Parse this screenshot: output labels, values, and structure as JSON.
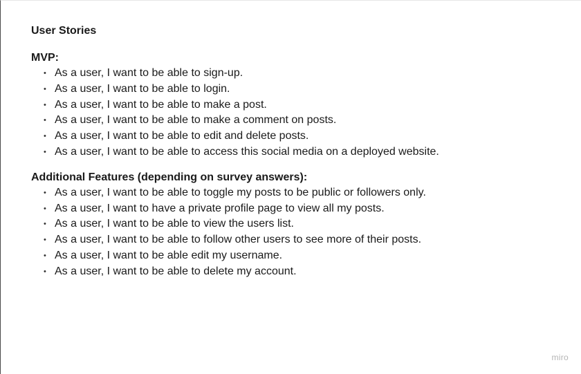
{
  "document": {
    "title": "User Stories",
    "sections": [
      {
        "heading": "MVP:",
        "items": [
          "As a user, I want to be able to sign-up.",
          "As a user, I want to be able to login.",
          "As a user, I want to be able to make a post.",
          "As a user, I want to be able to make a comment on posts.",
          "As a user, I want to be able to edit and delete posts.",
          "As a user, I want to be able to access this social media on a deployed website."
        ]
      },
      {
        "heading": "Additional Features (depending on survey answers):",
        "items": [
          "As a user, I want to be able to toggle my posts to be public or followers only.",
          "As a user, I want to have a private profile page to view all my posts.",
          "As a user, I want to be able to view the users list.",
          "As a user, I want to be able to follow other users to see more of their posts.",
          "As a user, I want to be able edit my username.",
          "As a user, I want to be able to delete my account."
        ]
      }
    ]
  },
  "watermark": "miro",
  "colors": {
    "text": "#1a1a1a",
    "watermark": "#b5b5b5",
    "background": "#ffffff"
  }
}
